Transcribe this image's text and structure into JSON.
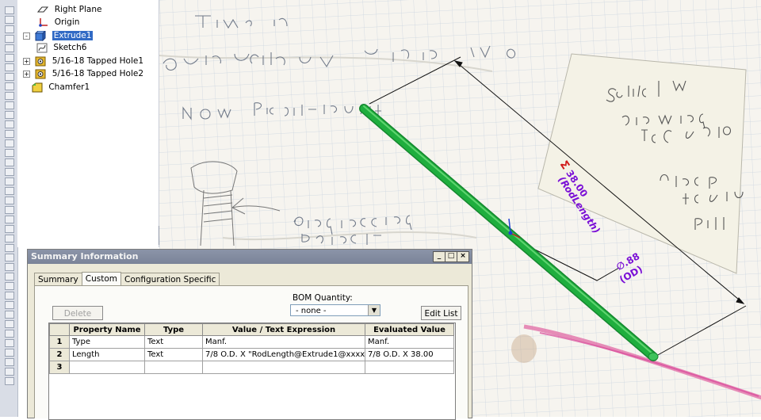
{
  "feature_tree": {
    "items": [
      {
        "label": "Right Plane",
        "icon": "plane-icon",
        "expander": ""
      },
      {
        "label": "Origin",
        "icon": "origin-icon",
        "expander": ""
      },
      {
        "label": "Extrude1",
        "icon": "extrude-icon",
        "expander": "-",
        "selected": true
      },
      {
        "label": "Sketch6",
        "icon": "sketch-icon",
        "expander": ""
      },
      {
        "label": "5/16-18 Tapped Hole1",
        "icon": "hole-icon",
        "expander": "+"
      },
      {
        "label": "5/16-18 Tapped Hole2",
        "icon": "hole-icon",
        "expander": "+"
      },
      {
        "label": "Chamfer1",
        "icon": "chamfer-icon",
        "expander": ""
      }
    ]
  },
  "viewport": {
    "dimension_value": "38.00",
    "dimension_prefix": "Σ",
    "dimension_name": "(RodLength)",
    "diameter_value": "∅.88",
    "diameter_name": "(OD)",
    "rod_color": "#1fae3e",
    "dimension_color": "#7a0fd6",
    "dimension_prefix_color": "#d01818"
  },
  "dialog": {
    "title": "Summary Information",
    "min_label": "_",
    "max_label": "□",
    "close_label": "×",
    "tabs": [
      "Summary",
      "Custom",
      "Configuration Specific"
    ],
    "active_tab": "Custom",
    "delete_label": "Delete",
    "bom_label": "BOM Quantity:",
    "bom_value": "- none -",
    "edit_list_label": "Edit List",
    "table": {
      "headers": [
        "Property Name",
        "Type",
        "Value / Text Expression",
        "Evaluated Value"
      ],
      "rows": [
        {
          "num": "1",
          "name": "Type",
          "type": "Text",
          "expr": "Manf.",
          "value": "Manf."
        },
        {
          "num": "2",
          "name": "Length",
          "type": "Text",
          "expr": "7/8 O.D. X \"RodLength@Extrude1@xxxxx",
          "value": "7/8 O.D. X 38.00"
        },
        {
          "num": "3",
          "name": "",
          "type": "",
          "expr": "",
          "value": ""
        }
      ]
    }
  }
}
